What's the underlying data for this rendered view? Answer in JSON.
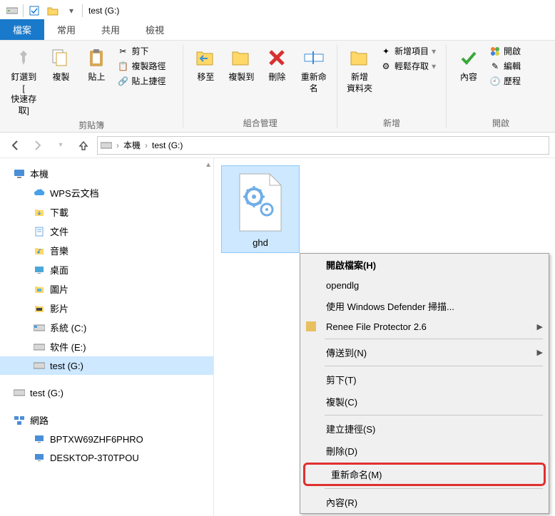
{
  "title": "test (G:)",
  "tabs": {
    "file": "檔案",
    "home": "常用",
    "share": "共用",
    "view": "檢視"
  },
  "ribbon": {
    "pin": "釘選到 [\n快速存取]",
    "copy": "複製",
    "paste": "貼上",
    "cut": "剪下",
    "copy_path": "複製路徑",
    "paste_shortcut": "貼上捷徑",
    "group_clipboard": "剪貼簿",
    "move_to": "移至",
    "copy_to": "複製到",
    "delete": "刪除",
    "rename": "重新命名",
    "group_organize": "組合管理",
    "new_folder": "新增\n資料夾",
    "new_item": "新增項目",
    "easy_access": "輕鬆存取",
    "group_new": "新增",
    "properties": "內容",
    "open_btn": "開啟",
    "edit": "編輯",
    "history": "歷程",
    "group_open": "開啟"
  },
  "breadcrumb": {
    "pc": "本機",
    "drive": "test (G:)"
  },
  "tree": {
    "this_pc": "本機",
    "wps": "WPS云文档",
    "downloads": "下載",
    "documents": "文件",
    "music": "音樂",
    "desktop": "桌面",
    "pictures": "圖片",
    "videos": "影片",
    "sys_c": "系統 (C:)",
    "soft_e": "软件 (E:)",
    "test_g": "test (G:)",
    "test_g2": "test (G:)",
    "network": "網路",
    "comp1": "BPTXW69ZHF6PHRO",
    "comp2": "DESKTOP-3T0TPOU"
  },
  "file": {
    "name": "ghd"
  },
  "ctx": {
    "open": "開啟檔案(H)",
    "opendlg": "opendlg",
    "defender": "使用 Windows Defender 掃描...",
    "renee": "Renee File Protector 2.6",
    "sendto": "傳送到(N)",
    "cut": "剪下(T)",
    "copy": "複製(C)",
    "shortcut": "建立捷徑(S)",
    "delete": "刪除(D)",
    "rename": "重新命名(M)",
    "props": "內容(R)"
  }
}
